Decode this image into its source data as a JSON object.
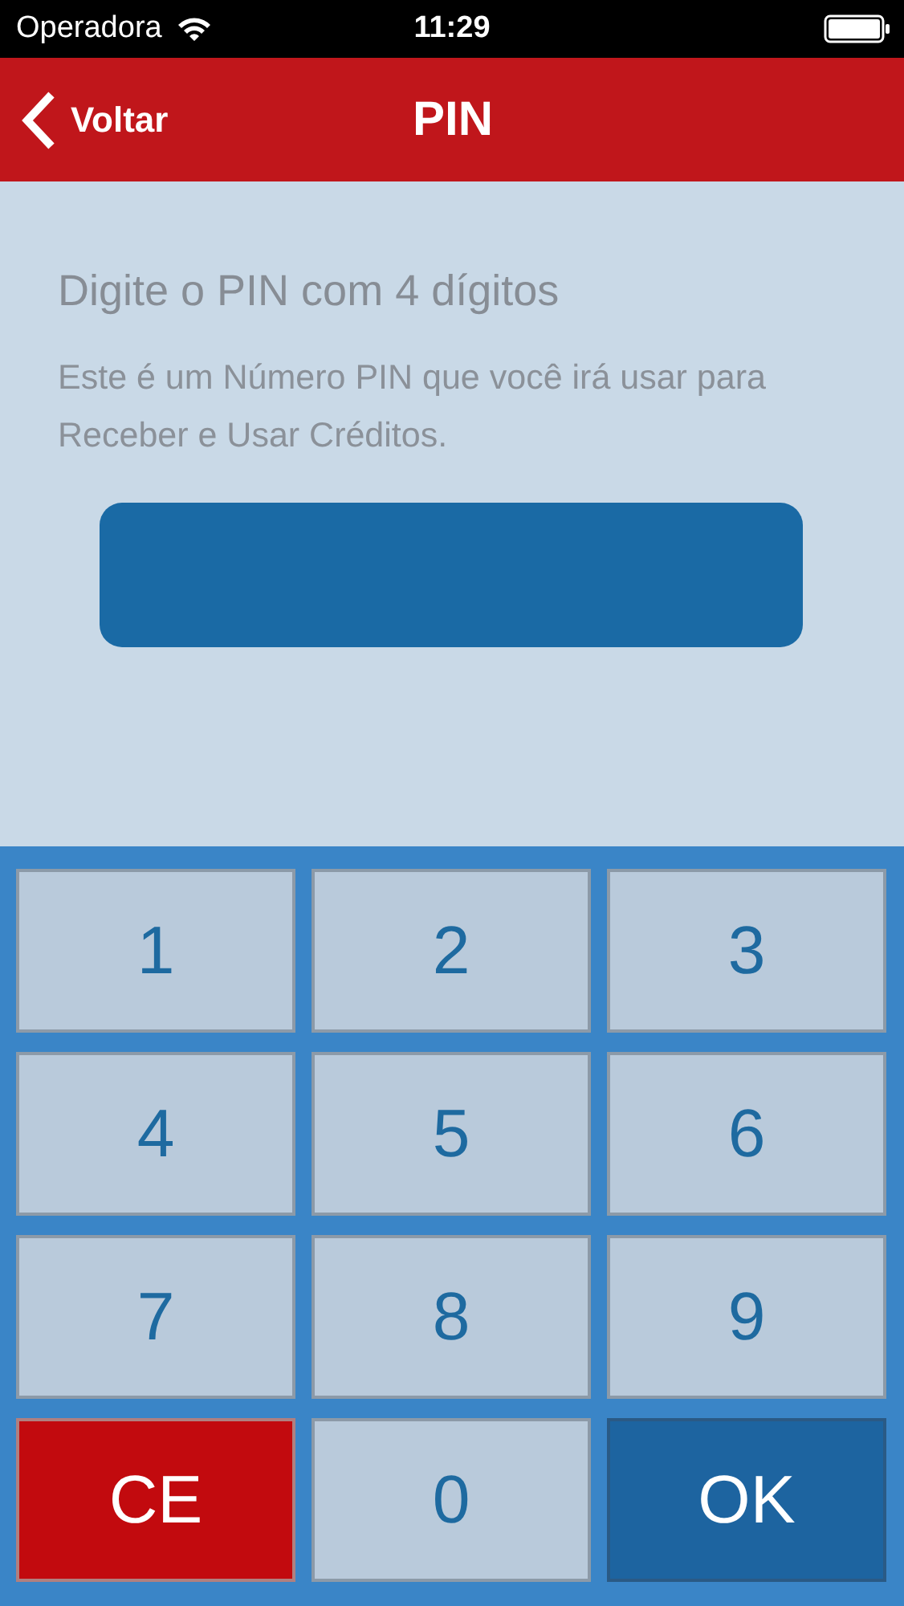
{
  "status_bar": {
    "carrier": "Operadora",
    "time": "11:29"
  },
  "nav_bar": {
    "back": "Voltar",
    "title": "PIN"
  },
  "prompt": {
    "title": "Digite o PIN com 4 dígitos",
    "description": "Este é um Número PIN que você irá usar para Receber e Usar Créditos."
  },
  "keypad": [
    {
      "label": "1",
      "kind": "digit"
    },
    {
      "label": "2",
      "kind": "digit"
    },
    {
      "label": "3",
      "kind": "digit"
    },
    {
      "label": "4",
      "kind": "digit"
    },
    {
      "label": "5",
      "kind": "digit"
    },
    {
      "label": "6",
      "kind": "digit"
    },
    {
      "label": "7",
      "kind": "digit"
    },
    {
      "label": "8",
      "kind": "digit"
    },
    {
      "label": "9",
      "kind": "digit"
    },
    {
      "label": "CE",
      "kind": "clear"
    },
    {
      "label": "0",
      "kind": "digit"
    },
    {
      "label": "OK",
      "kind": "confirm"
    }
  ]
}
